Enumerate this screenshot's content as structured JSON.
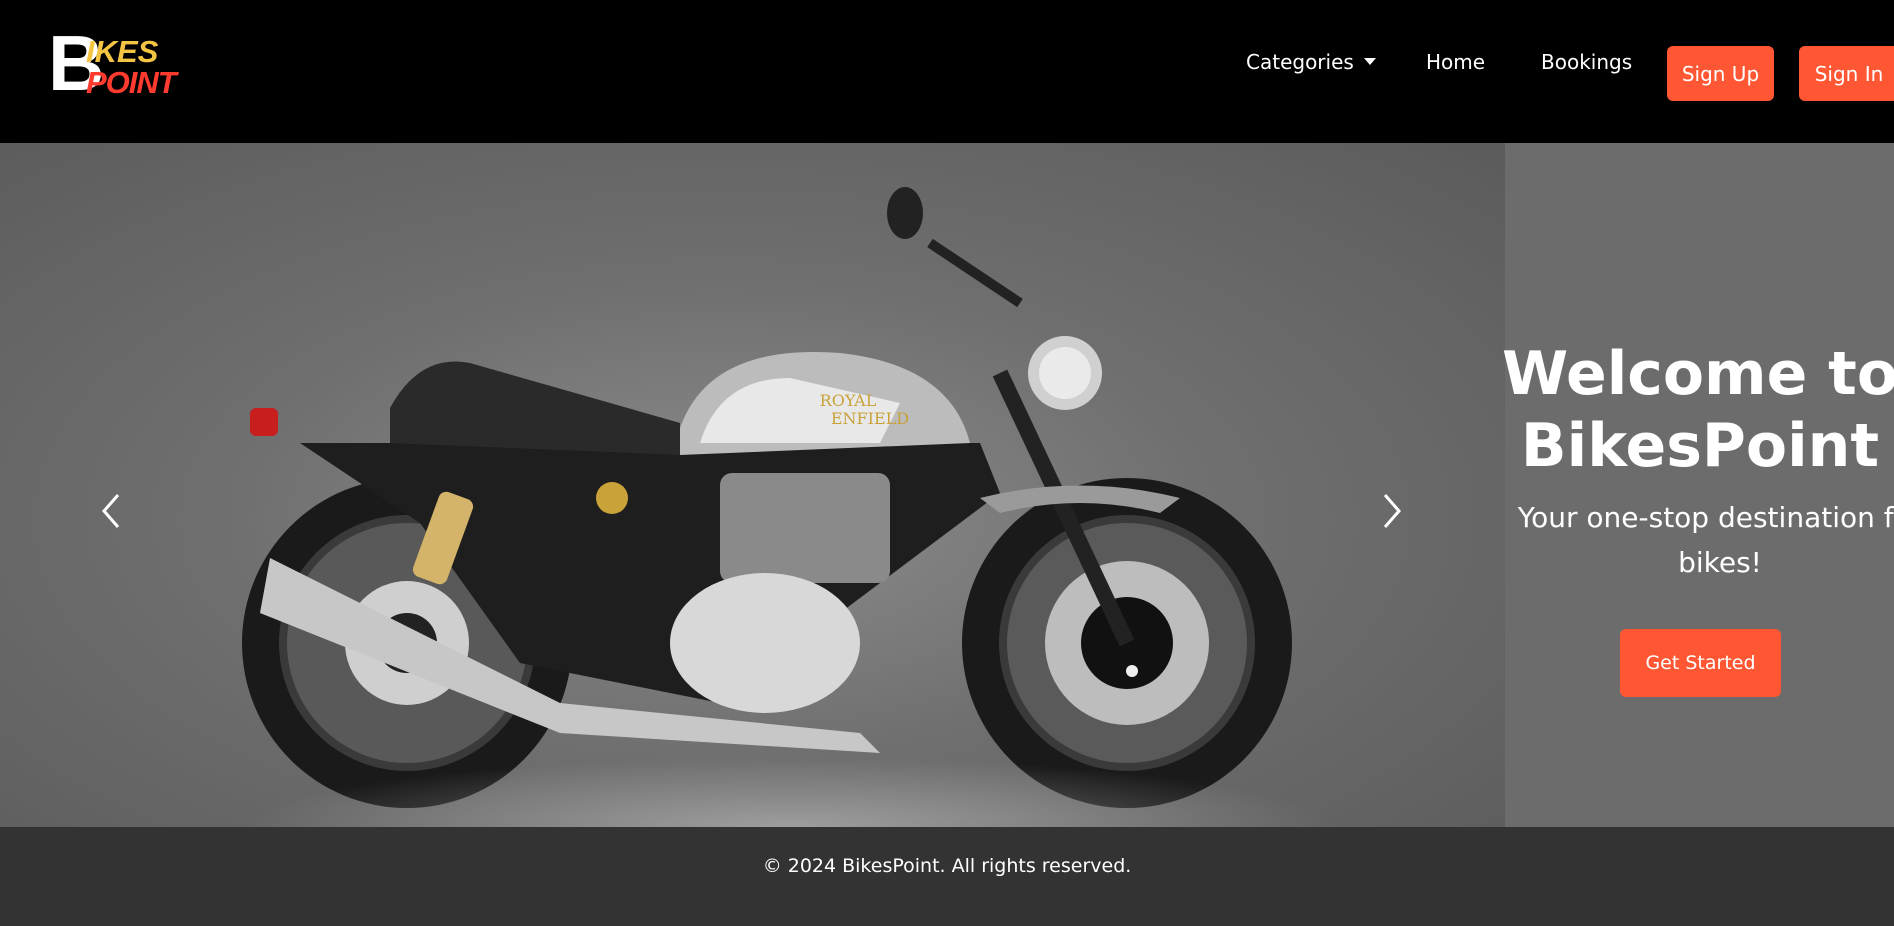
{
  "brand": {
    "logo_big_letter": "B",
    "logo_top": "IKES",
    "logo_bottom": "POINT"
  },
  "nav": {
    "categories_label": "Categories",
    "home_label": "Home",
    "bookings_label": "Bookings",
    "signup_label": "Sign Up",
    "signin_label": "Sign In"
  },
  "hero": {
    "title_line1": "Welcome to",
    "title_line2": "BikesPoint",
    "subtitle_line1": "Your one-stop destination for",
    "subtitle_line2": "bikes!",
    "cta_label": "Get Started",
    "tank_brand_line1": "ROYAL",
    "tank_brand_line2": "ENFIELD"
  },
  "footer": {
    "copyright": "© 2024 BikesPoint. All rights reserved."
  },
  "colors": {
    "accent": "#ff5733",
    "navbar_bg": "#000000",
    "hero_bg": "#6c6c6c",
    "footer_bg": "#333333",
    "logo_yellow": "#f4c542",
    "logo_red": "#ff3b2f"
  },
  "icons": {
    "categories_caret": "caret-down-icon",
    "carousel_prev": "chevron-left-icon",
    "carousel_next": "chevron-right-icon"
  }
}
